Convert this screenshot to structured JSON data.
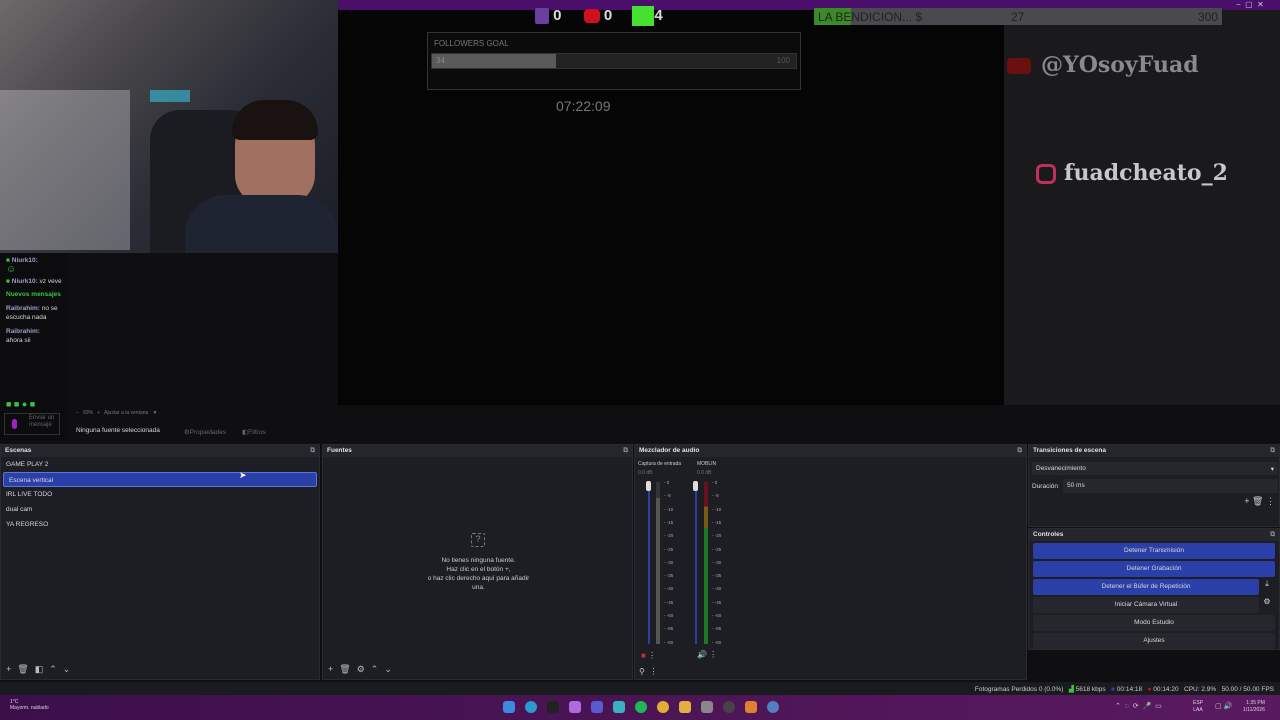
{
  "stream_overlay": {
    "twitch_count": "0",
    "youtube_count": "0",
    "kick_count": "4",
    "donation_goal": {
      "label": "LA BENDICION... $",
      "current": "27",
      "target": "300",
      "progress": 0.09
    },
    "followers_goal": {
      "label": "FOLLOWERS GOAL",
      "current": "34",
      "target": "100",
      "progress": 0.34
    },
    "clock": "07:22:09",
    "youtube_handle": "@YOsoyFuad",
    "instagram_handle": "fuadcheato_2"
  },
  "chat": {
    "messages": [
      {
        "user": "Niurk10:",
        "text": ""
      },
      {
        "user": "Niurk10:",
        "text": "vz veve"
      },
      {
        "user": "",
        "text": "Nuevos mensajes"
      },
      {
        "user": "Raibrahim:",
        "text": "no se escucha nada"
      },
      {
        "user": "Raibrahim:",
        "text": "ahora sii"
      }
    ],
    "input_placeholder": "Enviar un mensaje"
  },
  "zoom_bar": {
    "zoom": "69%",
    "fit_label": "Ajustar a la ventana"
  },
  "source_toolbar": {
    "no_source": "Ninguna fuente seleccionada",
    "properties": "Propiedades",
    "filters": "Filtros"
  },
  "scenes": {
    "title": "Escenas",
    "items": [
      "GAME PLAY 2",
      "Escena vertical",
      "IRL LIVE TODO",
      "dual cam",
      "YA REGRESO"
    ],
    "selected": 1
  },
  "sources": {
    "title": "Fuentes",
    "empty_lines": [
      "No tienes ninguna fuente.",
      "Haz clic en el botón +,",
      "o haz clic derecho aquí para añadir",
      "una."
    ]
  },
  "mixer": {
    "title": "Mezclador de audio",
    "channels": [
      {
        "name": "Captura de entrada",
        "db": "0.0 dB"
      },
      {
        "name": "MOBLIN",
        "db": "0.0 dB"
      }
    ],
    "ticks": [
      "0",
      "-5",
      "-10",
      "-15",
      "-20",
      "-25",
      "-30",
      "-35",
      "-40",
      "-45",
      "-50",
      "-55",
      "-60"
    ]
  },
  "transitions": {
    "title": "Transiciones de escena",
    "selected": "Desvanecimiento",
    "duration_label": "Duración",
    "duration": "50 ms"
  },
  "controls": {
    "title": "Controles",
    "buttons": [
      "Detener Transmisión",
      "Detener Grabación",
      "Detener el Búfer de Repetición",
      "Iniciar Cámara Virtual",
      "Modo Estudio",
      "Ajustes"
    ]
  },
  "status": {
    "dropped": "Fotogramas Perdidos 0 (0.0%)",
    "bitrate": "5618 kbps",
    "stream_time": "00:14:18",
    "rec_time": "00:14:20",
    "cpu": "CPU: 2.9%",
    "fps": "50.00 / 50.00 FPS"
  },
  "taskbar": {
    "weather_temp": "1°C",
    "weather_desc": "Mayorm. nublado",
    "lang1": "ESP",
    "lang2": "LAA",
    "time": "1:35 PM",
    "date": "1/11/2026"
  },
  "colors": {
    "accent": "#2a3fa8",
    "overlay_purple": "#4a0f6a",
    "taskbar": "#4a1555"
  }
}
